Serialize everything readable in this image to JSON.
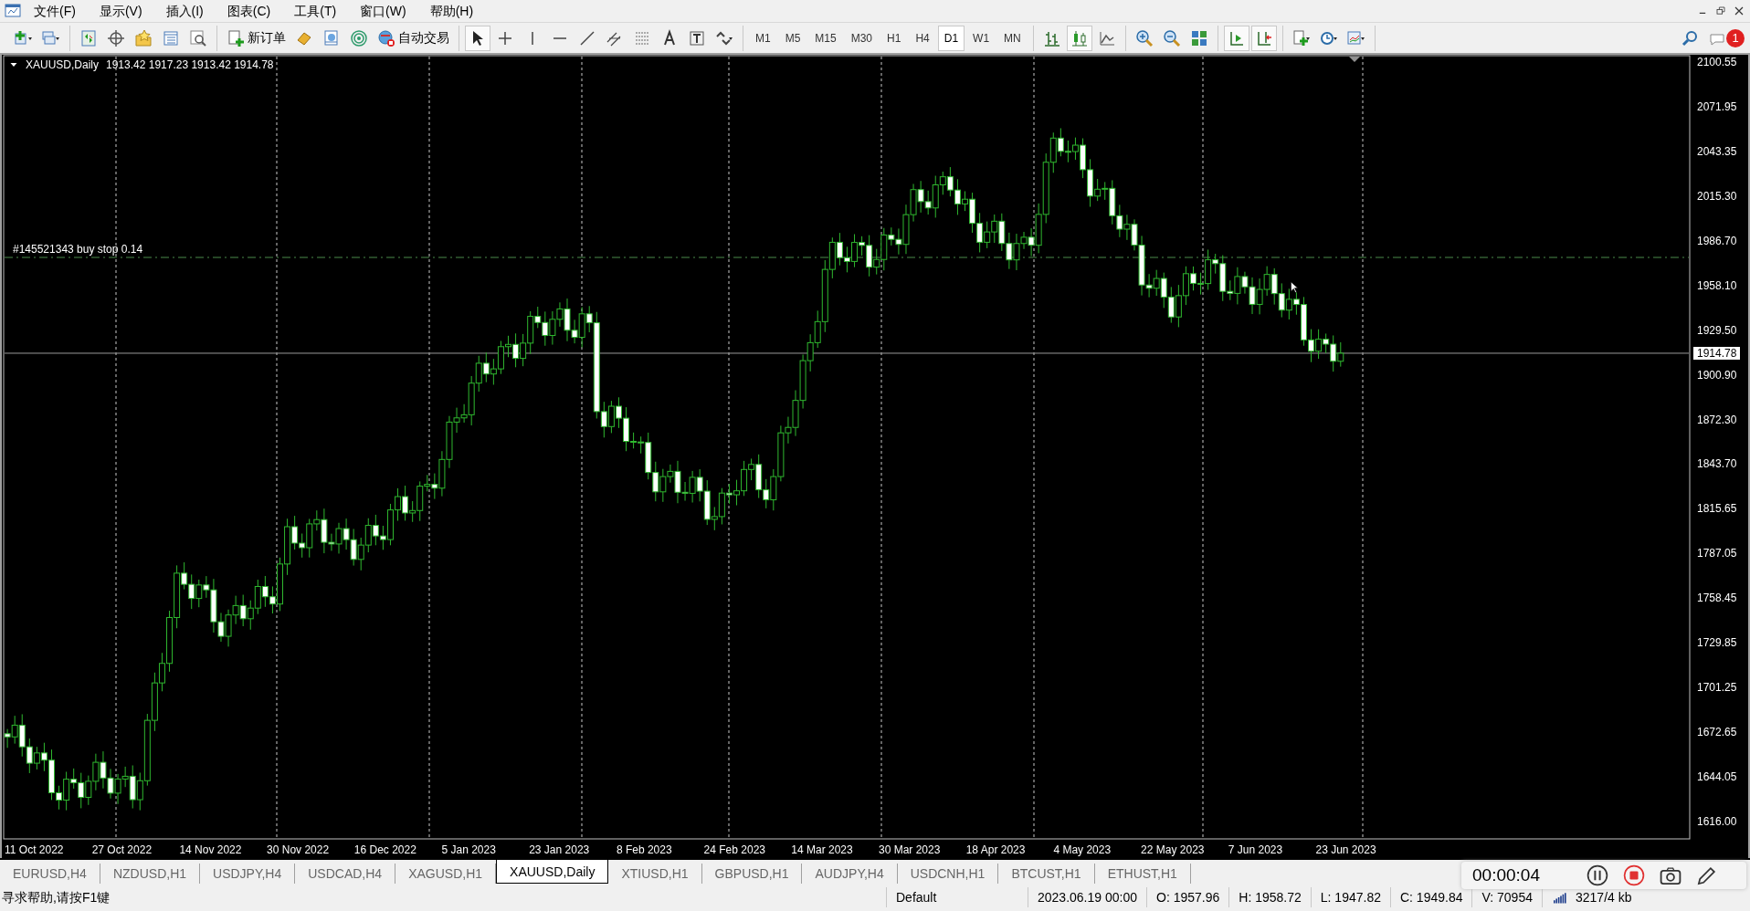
{
  "window": {
    "menu": [
      "文件(F)",
      "显示(V)",
      "插入(I)",
      "图表(C)",
      "工具(T)",
      "窗口(W)",
      "帮助(H)"
    ]
  },
  "toolbar": {
    "new_order": "新订单",
    "auto_trading": "自动交易",
    "timeframes": [
      {
        "label": "M1",
        "selected": false
      },
      {
        "label": "M5",
        "selected": false
      },
      {
        "label": "M15",
        "selected": false
      },
      {
        "label": "M30",
        "selected": false
      },
      {
        "label": "H1",
        "selected": false
      },
      {
        "label": "H4",
        "selected": false
      },
      {
        "label": "D1",
        "selected": true
      },
      {
        "label": "W1",
        "selected": false
      },
      {
        "label": "MN",
        "selected": false
      }
    ],
    "chart_type_buttons": [
      {
        "selected": false
      },
      {
        "selected": true
      },
      {
        "selected": false
      }
    ],
    "scroll_buttons": [
      {
        "pressed": true
      },
      {
        "pressed": true
      }
    ],
    "notification_badge": "1"
  },
  "chart": {
    "symbol": "XAUUSD,Daily",
    "ohlc": "1913.42 1917.23 1913.42 1914.78",
    "order_label": "#145521343 buy stop 0.14",
    "current_price": "1914.78",
    "price_labels": [
      "2100.55",
      "2071.95",
      "2043.35",
      "2015.30",
      "1986.70",
      "1958.10",
      "1929.50",
      "1900.90",
      "1872.30",
      "1843.70",
      "1815.65",
      "1787.05",
      "1758.45",
      "1729.85",
      "1701.25",
      "1672.65",
      "1644.05",
      "1616.00"
    ],
    "date_labels": [
      "11 Oct 2022",
      "27 Oct 2022",
      "14 Nov 2022",
      "30 Nov 2022",
      "16 Dec 2022",
      "5 Jan 2023",
      "23 Jan 2023",
      "8 Feb 2023",
      "24 Feb 2023",
      "14 Mar 2023",
      "30 Mar 2023",
      "18 Apr 2023",
      "4 May 2023",
      "22 May 2023",
      "7 Jun 2023",
      "23 Jun 2023"
    ]
  },
  "chart_tabs": [
    {
      "label": "EURUSD,H4",
      "selected": false
    },
    {
      "label": "NZDUSD,H1",
      "selected": false
    },
    {
      "label": "USDJPY,H4",
      "selected": false
    },
    {
      "label": "USDCAD,H4",
      "selected": false
    },
    {
      "label": "XAGUSD,H1",
      "selected": false
    },
    {
      "label": "XAUUSD,Daily",
      "selected": true
    },
    {
      "label": "XTIUSD,H1",
      "selected": false
    },
    {
      "label": "GBPUSD,H1",
      "selected": false
    },
    {
      "label": "AUDJPY,H4",
      "selected": false
    },
    {
      "label": "USDCNH,H1",
      "selected": false
    },
    {
      "label": "BTCUST,H1",
      "selected": false
    },
    {
      "label": "ETHUST,H1",
      "selected": false
    }
  ],
  "status_bar": {
    "help": "寻求帮助,请按F1键",
    "profile": "Default",
    "time": "2023.06.19 00:00",
    "open": "O: 1957.96",
    "high": "H: 1958.72",
    "low": "L: 1947.82",
    "close": "C: 1949.84",
    "volume": "V: 70954",
    "traffic": "3217/4 kb"
  },
  "recorder": {
    "elapsed": "00:00:04"
  }
}
